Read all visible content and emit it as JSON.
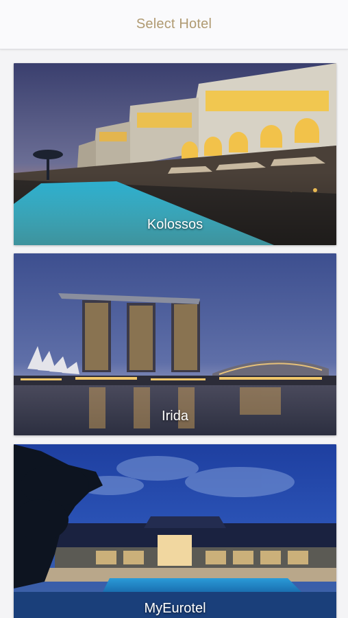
{
  "header": {
    "title": "Select Hotel"
  },
  "hotels": [
    {
      "name": "Kolossos"
    },
    {
      "name": "Irida"
    },
    {
      "name": "MyEurotel"
    }
  ]
}
